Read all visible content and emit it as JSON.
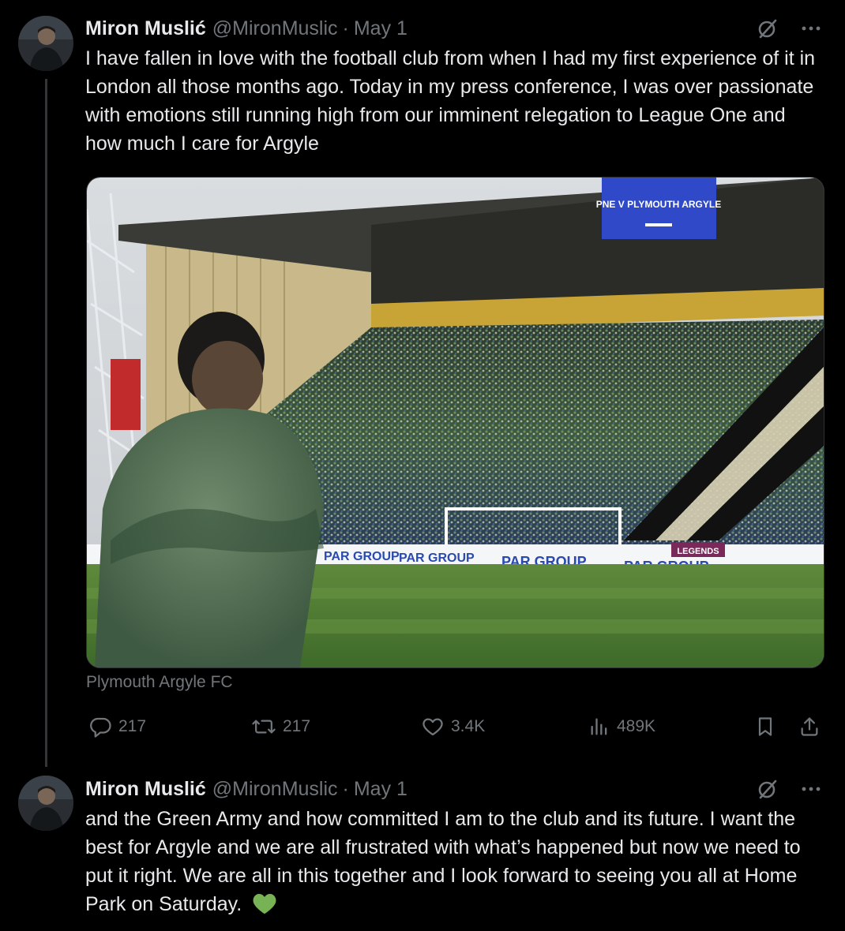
{
  "tweets": [
    {
      "author_name": "Miron Muslić",
      "handle": "@MironMuslic",
      "separator": "·",
      "date": "May 1",
      "text": "I have fallen in love with the football club from when I had my first experience of it in London all those months ago. Today in my press conference, I was over passionate with emotions still running high from our imminent relegation to League One and how much I care for Argyle",
      "media": {
        "scoreboard_text": "PNE V PLYMOUTH ARGYLE",
        "ad_board_text": "PAR GROUP",
        "legends_text": "LEGENDS",
        "caption": "Plymouth Argyle FC"
      },
      "actions": {
        "replies": "217",
        "reposts": "217",
        "likes": "3.4K",
        "views": "489K"
      }
    },
    {
      "author_name": "Miron Muslić",
      "handle": "@MironMuslic",
      "separator": "·",
      "date": "May 1",
      "text": "and the Green Army and how committed I am to the club and its future. I want the best for Argyle and we are all frustrated with what’s happened but now we need to put it right. We are all in this together and I look forward to seeing you all at Home Park on Saturday.",
      "emoji": "green-heart"
    }
  ],
  "colors": {
    "background": "#000000",
    "primary_text": "#e7e9ea",
    "secondary_text": "#71767b",
    "heart_green": "#77b255"
  },
  "icons": [
    "grok-icon",
    "more-icon",
    "reply-icon",
    "repost-icon",
    "like-icon",
    "views-icon",
    "bookmark-icon",
    "share-icon"
  ]
}
